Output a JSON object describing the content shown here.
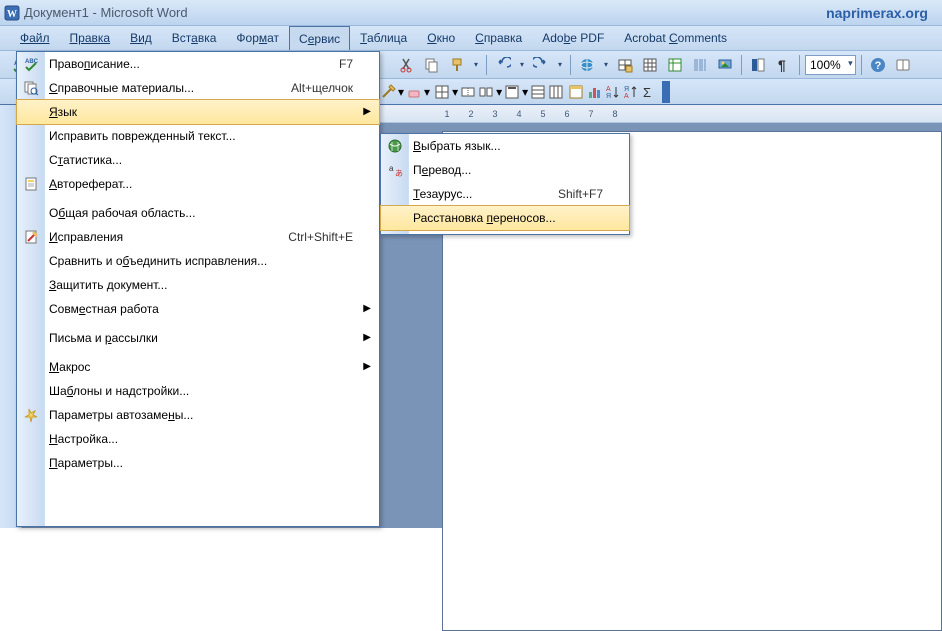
{
  "title": "Документ1 - Microsoft Word",
  "watermark": "naprimerax.org",
  "menubar": {
    "file": "Файл",
    "edit": "Правка",
    "view": "Вид",
    "insert": "Вставка",
    "format": "Формат",
    "tools": "Сервис",
    "table": "Таблица",
    "window": "Окно",
    "help": "Справка",
    "adobe": "Adobe PDF",
    "acrobat": "Acrobat Comments"
  },
  "zoom": "100%",
  "ruler": [
    "1",
    "2",
    "3",
    "4",
    "5",
    "6",
    "7",
    "8"
  ],
  "tools_menu": {
    "spelling": "Правописание...",
    "spelling_sc": "F7",
    "research": "Справочные материалы...",
    "research_sc": "Alt+щелчок",
    "language": "Язык",
    "fix_text": "Исправить поврежденный текст...",
    "stats": "Статистика...",
    "autosummarize": "Автореферат...",
    "shared_ws": "Общая рабочая область...",
    "track_changes": "Исправления",
    "track_changes_sc": "Ctrl+Shift+E",
    "compare": "Сравнить и объединить исправления...",
    "protect": "Защитить документ...",
    "collab": "Совместная работа",
    "mail": "Письма и рассылки",
    "macro": "Макрос",
    "templates": "Шаблоны и надстройки...",
    "autocorrect": "Параметры автозамены...",
    "customize": "Настройка...",
    "options": "Параметры..."
  },
  "lang_menu": {
    "set_lang": "Выбрать язык...",
    "translate": "Перевод...",
    "thesaurus": "Тезаурус...",
    "thesaurus_sc": "Shift+F7",
    "hyphenation": "Расстановка переносов..."
  }
}
